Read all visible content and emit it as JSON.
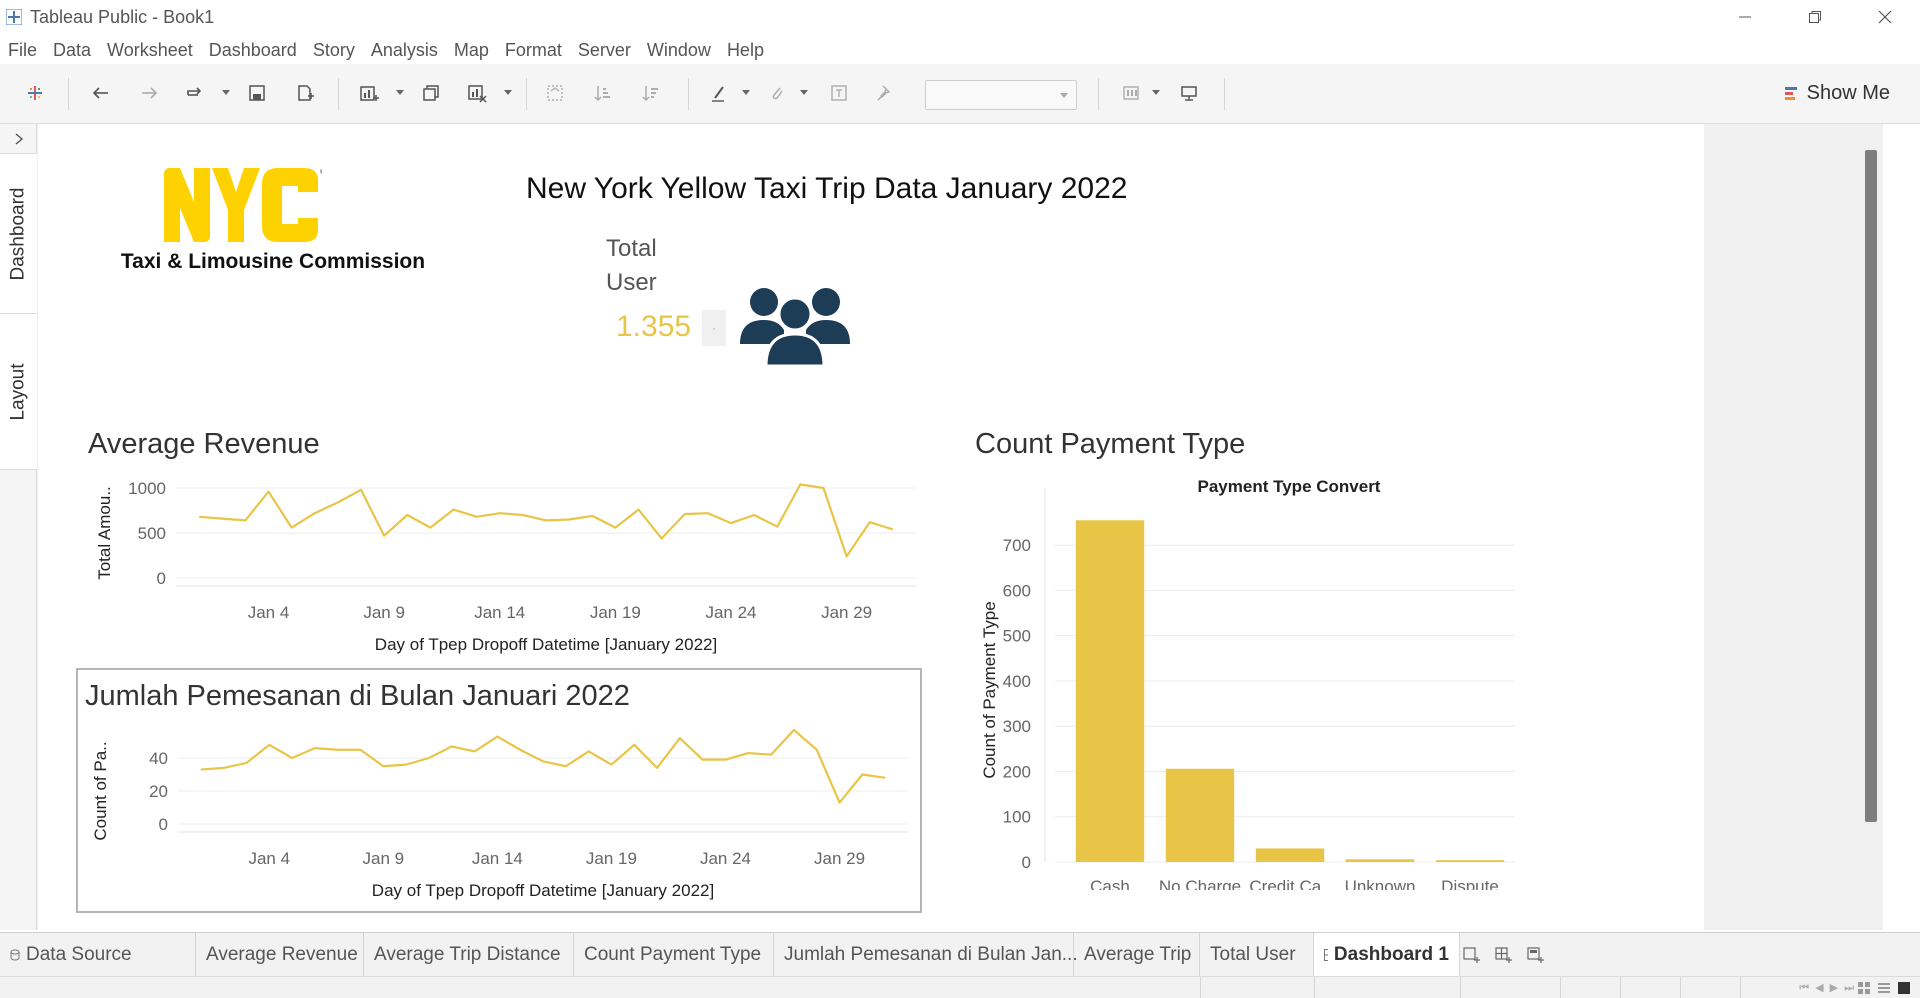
{
  "window": {
    "title": "Tableau Public - Book1",
    "controls": [
      "minimize",
      "restore",
      "close"
    ]
  },
  "menu": [
    "File",
    "Data",
    "Worksheet",
    "Dashboard",
    "Story",
    "Analysis",
    "Map",
    "Format",
    "Server",
    "Window",
    "Help"
  ],
  "toolbar": {
    "show_me": "Show Me",
    "show_me_colors": [
      "#4e79a7",
      "#e15759",
      "#f28e2b"
    ]
  },
  "side_panel": {
    "tabs": [
      "Dashboard",
      "Layout"
    ]
  },
  "dashboard": {
    "title": "New York Yellow Taxi Trip Data January 2022",
    "logo": {
      "mark": "NYC",
      "subtitle": "Taxi & Limousine Commission",
      "color": "#fed100"
    },
    "kpi": {
      "label_line1": "Total",
      "label_line2": "User",
      "value": "1.355",
      "chip": "·",
      "icon": "users-group-icon",
      "icon_color": "#1d3c55",
      "value_color": "#e8c547"
    },
    "accent_color": "#e8c547"
  },
  "sheets": {
    "avg_revenue": {
      "title": "Average Revenue"
    },
    "bookings": {
      "title": "Jumlah Pemesanan di Bulan Januari 2022"
    },
    "payment": {
      "title": "Count Payment Type"
    }
  },
  "chart_data": [
    {
      "id": "avg_revenue",
      "type": "line",
      "xlabel": "Day of Tpep Dropoff Datetime [January 2022]",
      "ylabel": "Total Amou..",
      "x_ticks": [
        "Jan 4",
        "Jan 9",
        "Jan 14",
        "Jan 19",
        "Jan 24",
        "Jan 29"
      ],
      "x_tick_days": [
        4,
        9,
        14,
        19,
        24,
        29
      ],
      "y_ticks": [
        0,
        500,
        1000
      ],
      "ylim": [
        0,
        1000
      ],
      "xlim": [
        0,
        32
      ],
      "x": [
        1,
        2,
        3,
        4,
        5,
        6,
        7,
        8,
        9,
        10,
        11,
        12,
        13,
        14,
        15,
        16,
        17,
        18,
        19,
        20,
        21,
        22,
        23,
        24,
        25,
        26,
        27,
        28,
        29,
        30,
        31
      ],
      "values": [
        680,
        660,
        640,
        960,
        560,
        720,
        840,
        980,
        470,
        700,
        560,
        760,
        680,
        720,
        700,
        640,
        650,
        690,
        560,
        760,
        440,
        710,
        720,
        610,
        700,
        570,
        1040,
        1000,
        240,
        620,
        540
      ],
      "grid": true
    },
    {
      "id": "bookings",
      "type": "line",
      "xlabel": "Day of Tpep Dropoff Datetime [January 2022]",
      "ylabel": "Count of Pa..",
      "x_ticks": [
        "Jan 4",
        "Jan 9",
        "Jan 14",
        "Jan 19",
        "Jan 24",
        "Jan 29"
      ],
      "x_tick_days": [
        4,
        9,
        14,
        19,
        24,
        29
      ],
      "y_ticks": [
        0,
        20,
        40
      ],
      "ylim": [
        0,
        40
      ],
      "xlim": [
        0,
        32
      ],
      "x": [
        1,
        2,
        3,
        4,
        5,
        6,
        7,
        8,
        9,
        10,
        11,
        12,
        13,
        14,
        15,
        16,
        17,
        18,
        19,
        20,
        21,
        22,
        23,
        24,
        25,
        26,
        27,
        28,
        29,
        30,
        31
      ],
      "values": [
        33,
        34,
        37,
        48,
        40,
        46,
        45,
        45,
        35,
        36,
        40,
        47,
        44,
        53,
        45,
        38,
        35,
        44,
        36,
        48,
        34,
        52,
        39,
        39,
        43,
        42,
        57,
        45,
        13,
        30,
        28
      ],
      "grid": true
    },
    {
      "id": "payment",
      "type": "bar",
      "title": "Payment Type Convert",
      "ylabel": "Count of Payment Type",
      "categories": [
        "Cash",
        "No Charge",
        "Credit Ca..",
        "Unknown",
        "Dispute"
      ],
      "values": [
        755,
        206,
        30,
        6,
        4
      ],
      "y_ticks": [
        0,
        100,
        200,
        300,
        400,
        500,
        600,
        700
      ],
      "ylim": [
        0,
        760
      ],
      "grid": true
    }
  ],
  "tabs": [
    {
      "label": "Data Source",
      "icon": "data-source-icon"
    },
    {
      "label": "Average Revenue"
    },
    {
      "label": "Average Trip Distance"
    },
    {
      "label": "Count Payment Type"
    },
    {
      "label": "Jumlah Pemesanan di Bulan Jan..."
    },
    {
      "label": "Average Trip"
    },
    {
      "label": "Total User"
    },
    {
      "label": "Dashboard 1",
      "active": true,
      "icon": "dashboard-icon"
    }
  ]
}
